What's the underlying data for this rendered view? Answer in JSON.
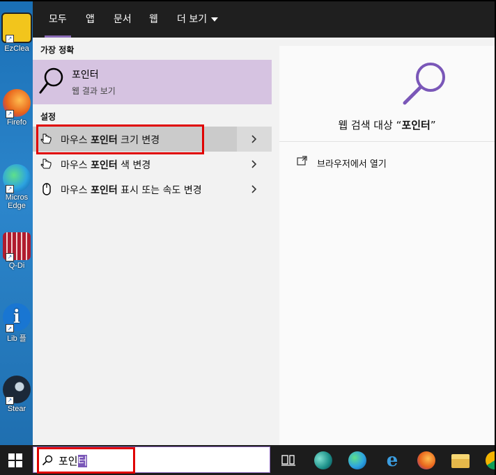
{
  "tabs": [
    {
      "label": "모두",
      "active": true
    },
    {
      "label": "앱",
      "active": false
    },
    {
      "label": "문서",
      "active": false
    },
    {
      "label": "웹",
      "active": false
    },
    {
      "label": "더 보기",
      "active": false
    }
  ],
  "best_match": {
    "section_title": "가장 정확",
    "title": "포인터",
    "subtitle": "웹 결과 보기"
  },
  "settings": {
    "section_title": "설정",
    "items": [
      {
        "prefix": "마우스 ",
        "bold": "포인터",
        "suffix": " 크기 변경",
        "icon": "pointer-hand-icon"
      },
      {
        "prefix": "마우스 ",
        "bold": "포인터",
        "suffix": " 색 변경",
        "icon": "pointer-hand-icon"
      },
      {
        "prefix": "마우스 ",
        "bold": "포인터",
        "suffix": " 표시 또는 속도 변경",
        "icon": "mouse-icon"
      }
    ]
  },
  "preview": {
    "title_prefix": "웹 검색 대상 “",
    "title_bold": "포인터",
    "title_suffix": "”",
    "action": "브라우저에서 열기"
  },
  "search_box": {
    "query_plain": "포인",
    "query_selected": "터"
  },
  "desktop_icons": [
    {
      "label": "EzClea",
      "color": "#f2c51c"
    },
    {
      "label": "Firefo",
      "color": "#e8641b"
    },
    {
      "label": "Micros Edge",
      "color": "#2da3e0"
    },
    {
      "label": "Q-Di",
      "color": "#b01b2e"
    },
    {
      "label": "Lib 플",
      "color": "#1976d2"
    },
    {
      "label": "Stear",
      "color": "#1b2838"
    }
  ],
  "colors": {
    "accent": "#8a6bb6",
    "highlight_red": "#e00000",
    "best_match_bg": "#d6c3e1"
  }
}
